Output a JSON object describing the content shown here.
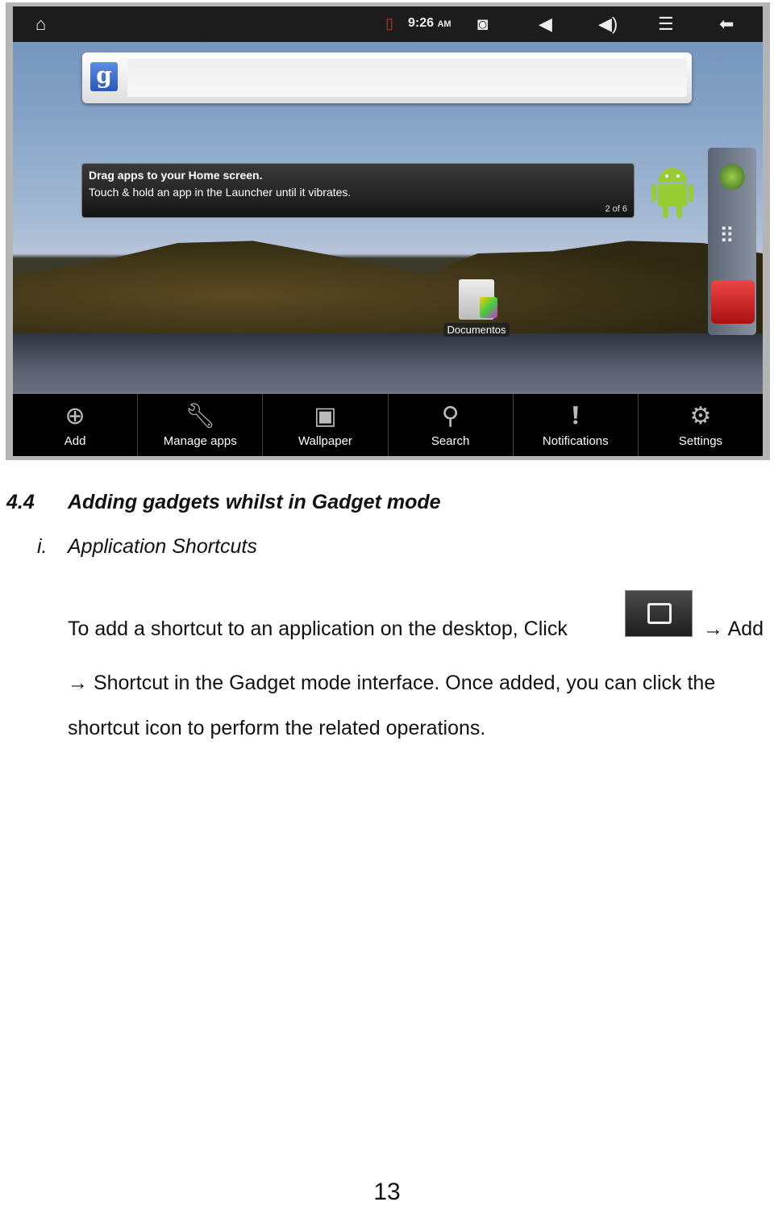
{
  "screenshot": {
    "status_bar": {
      "time": "9:26",
      "ampm": "AM"
    },
    "tooltip": {
      "title": "Drag apps to your Home screen.",
      "body": "Touch & hold an app in the Launcher until it vibrates.",
      "counter": "2 of 6"
    },
    "desktop_icon": {
      "label": "Documentos"
    },
    "menu": [
      {
        "label": "Add",
        "icon": "plus-circle"
      },
      {
        "label": "Manage apps",
        "icon": "wrench"
      },
      {
        "label": "Wallpaper",
        "icon": "picture"
      },
      {
        "label": "Search",
        "icon": "magnifier"
      },
      {
        "label": "Notifications",
        "icon": "exclamation"
      },
      {
        "label": "Settings",
        "icon": "gear"
      }
    ]
  },
  "doc": {
    "section_number": "4.4",
    "section_title": "Adding gadgets whilst in Gadget mode",
    "sub_number": "i.",
    "sub_title": "Application Shortcuts",
    "line1a": "To add a shortcut to an application on the desktop, Click",
    "line1b": "→ Add",
    "line2": "→ Shortcut in the Gadget mode interface. Once added, you can click the",
    "line3": "shortcut icon to perform the related operations.",
    "page_number": "13"
  }
}
